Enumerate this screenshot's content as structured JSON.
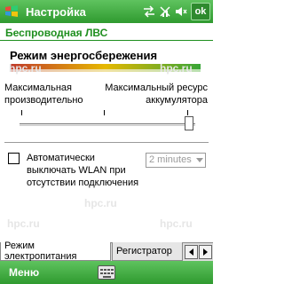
{
  "titlebar": {
    "title": "Настройка",
    "ok_label": "ok"
  },
  "section": {
    "header": "Беспроводная ЛВС"
  },
  "power": {
    "mode_label": "Режим энергосбережения",
    "left_label": "Максимальная производительно",
    "right_label": "Максимальный ресурс аккумулятора",
    "slider_level_percent": 100
  },
  "auto_off": {
    "label": "Автоматически выключать WLAN при отсутствии подключения",
    "checked": false,
    "dropdown_value": "2 minutes"
  },
  "watermark": "hpc.ru",
  "tabs": [
    {
      "label": "Режим электропитания",
      "active": true
    },
    {
      "label": "Регистратор",
      "active": false
    }
  ],
  "menubar": {
    "menu_label": "Меню"
  },
  "colors": {
    "accent_green": "#2f9a2f",
    "header_green": "#1f8f1f"
  }
}
